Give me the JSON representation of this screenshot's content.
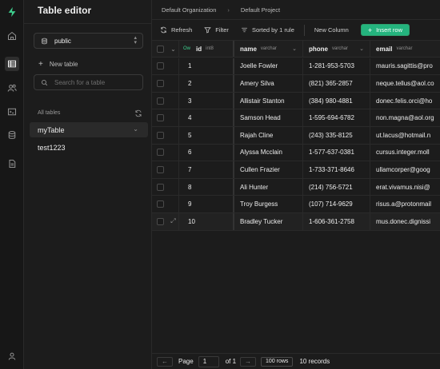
{
  "rail": {
    "items": [
      "home-icon",
      "table-editor-icon",
      "users-icon",
      "terminal-icon",
      "database-icon",
      "document-icon"
    ],
    "bottom": "user-icon"
  },
  "sidebar": {
    "title": "Table editor",
    "schema": "public",
    "new_table": "New table",
    "search_placeholder": "Search for a table",
    "all_tables": "All tables",
    "tables": [
      "myTable",
      "test1223"
    ]
  },
  "topbar": {
    "organization": "Default Organization",
    "project": "Default Project"
  },
  "toolbar": {
    "refresh": "Refresh",
    "filter": "Filter",
    "sort": "Sorted by 1 rule",
    "new_column": "New Column",
    "insert_row": "Insert row"
  },
  "columns": [
    {
      "name": "id",
      "type": "int8",
      "key": "Ow"
    },
    {
      "name": "name",
      "type": "varchar"
    },
    {
      "name": "phone",
      "type": "varchar"
    },
    {
      "name": "email",
      "type": "varchar"
    }
  ],
  "rows": [
    {
      "id": "1",
      "name": "Joelle Fowler",
      "phone": "1-281-953-5703",
      "email": "mauris.sagittis@pro"
    },
    {
      "id": "2",
      "name": "Amery Silva",
      "phone": "(821) 365-2857",
      "email": "neque.tellus@aol.co"
    },
    {
      "id": "3",
      "name": "Allistair Stanton",
      "phone": "(384) 980-4881",
      "email": "donec.felis.orci@ho"
    },
    {
      "id": "4",
      "name": "Samson Head",
      "phone": "1-595-694-6782",
      "email": "non.magna@aol.org"
    },
    {
      "id": "5",
      "name": "Rajah Cline",
      "phone": "(243) 335-8125",
      "email": "ut.lacus@hotmail.n"
    },
    {
      "id": "6",
      "name": "Alyssa Mcclain",
      "phone": "1-577-637-0381",
      "email": "cursus.integer.moll"
    },
    {
      "id": "7",
      "name": "Cullen Frazier",
      "phone": "1-733-371-8646",
      "email": "ullamcorper@goog"
    },
    {
      "id": "8",
      "name": "Ali Hunter",
      "phone": "(214) 756-5721",
      "email": "erat.vivamus.nisi@"
    },
    {
      "id": "9",
      "name": "Troy Burgess",
      "phone": "(107) 714-9629",
      "email": "risus.a@protonmail"
    },
    {
      "id": "10",
      "name": "Bradley Tucker",
      "phone": "1-606-361-2758",
      "email": "mus.donec.dignissi"
    }
  ],
  "footer": {
    "page_label": "Page",
    "page": "1",
    "of": "of 1",
    "rows": "100 rows",
    "records": "10 records"
  },
  "colors": {
    "accent": "#24b47e",
    "background": "#1c1c1c"
  }
}
